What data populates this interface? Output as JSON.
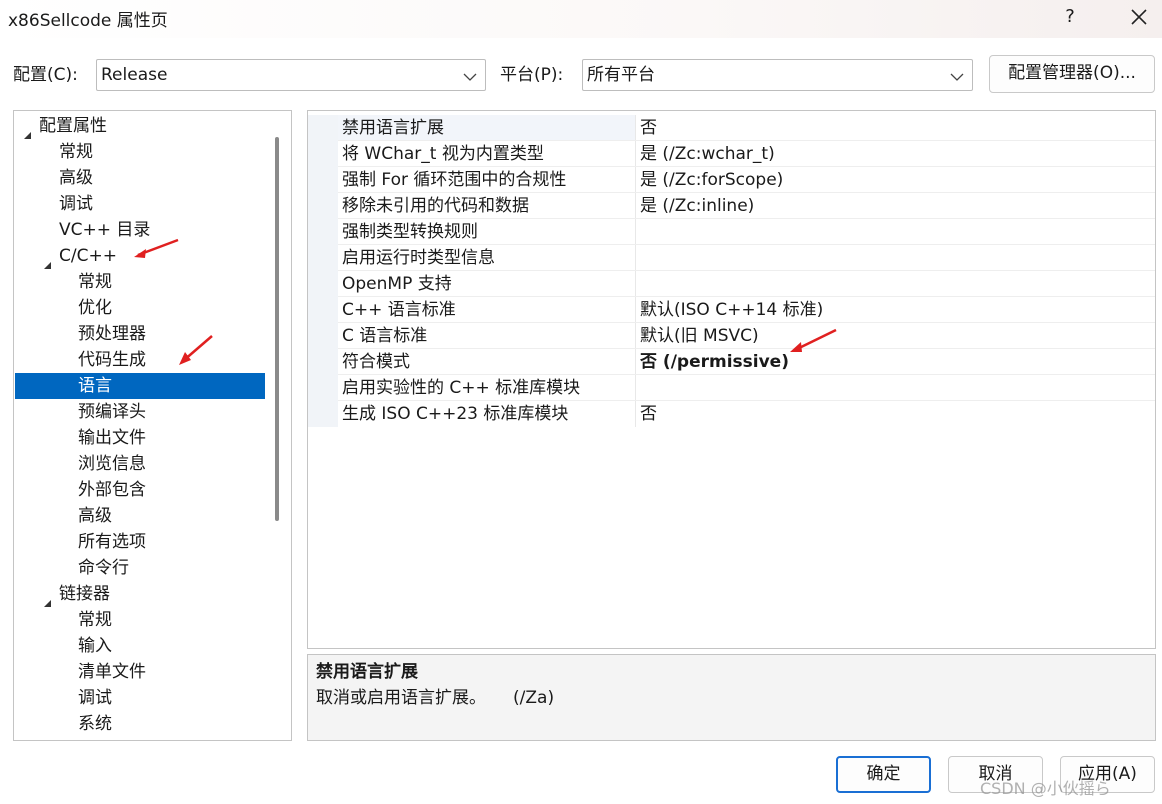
{
  "window": {
    "title": "x86Sellcode 属性页",
    "help": "?"
  },
  "top": {
    "config_label": "配置(C):",
    "config_value": "Release",
    "platform_label": "平台(P):",
    "platform_value": "所有平台",
    "manager_button": "配置管理器(O)..."
  },
  "tree": {
    "items": [
      {
        "label": "配置属性"
      },
      {
        "label": "常规"
      },
      {
        "label": "高级"
      },
      {
        "label": "调试"
      },
      {
        "label": "VC++ 目录"
      },
      {
        "label": "C/C++"
      },
      {
        "label": "常规"
      },
      {
        "label": "优化"
      },
      {
        "label": "预处理器"
      },
      {
        "label": "代码生成"
      },
      {
        "label": "语言"
      },
      {
        "label": "预编译头"
      },
      {
        "label": "输出文件"
      },
      {
        "label": "浏览信息"
      },
      {
        "label": "外部包含"
      },
      {
        "label": "高级"
      },
      {
        "label": "所有选项"
      },
      {
        "label": "命令行"
      },
      {
        "label": "链接器"
      },
      {
        "label": "常规"
      },
      {
        "label": "输入"
      },
      {
        "label": "清单文件"
      },
      {
        "label": "调试"
      },
      {
        "label": "系统"
      }
    ],
    "selected": "语言"
  },
  "properties": [
    {
      "name": "禁用语言扩展",
      "value": "否"
    },
    {
      "name": "将 WChar_t 视为内置类型",
      "value": "是 (/Zc:wchar_t)"
    },
    {
      "name": "强制 For 循环范围中的合规性",
      "value": "是 (/Zc:forScope)"
    },
    {
      "name": "移除未引用的代码和数据",
      "value": "是 (/Zc:inline)"
    },
    {
      "name": "强制类型转换规则",
      "value": ""
    },
    {
      "name": "启用运行时类型信息",
      "value": ""
    },
    {
      "name": "OpenMP 支持",
      "value": ""
    },
    {
      "name": "C++ 语言标准",
      "value": "默认(ISO C++14 标准)"
    },
    {
      "name": "C 语言标准",
      "value": "默认(旧 MSVC)"
    },
    {
      "name": "符合模式",
      "value": "否 (/permissive)"
    },
    {
      "name": "启用实验性的 C++ 标准库模块",
      "value": ""
    },
    {
      "name": "生成 ISO C++23 标准库模块",
      "value": "否"
    }
  ],
  "description": {
    "title": "禁用语言扩展",
    "text": "取消或启用语言扩展。     (/Za)"
  },
  "buttons": {
    "ok": "确定",
    "cancel": "取消",
    "apply": "应用(A)"
  },
  "watermark": "CSDN @小伙摇ら",
  "colors": {
    "selection": "#0067c0",
    "annotation_arrow": "#e02020",
    "primary_border": "#1a6fd4"
  }
}
